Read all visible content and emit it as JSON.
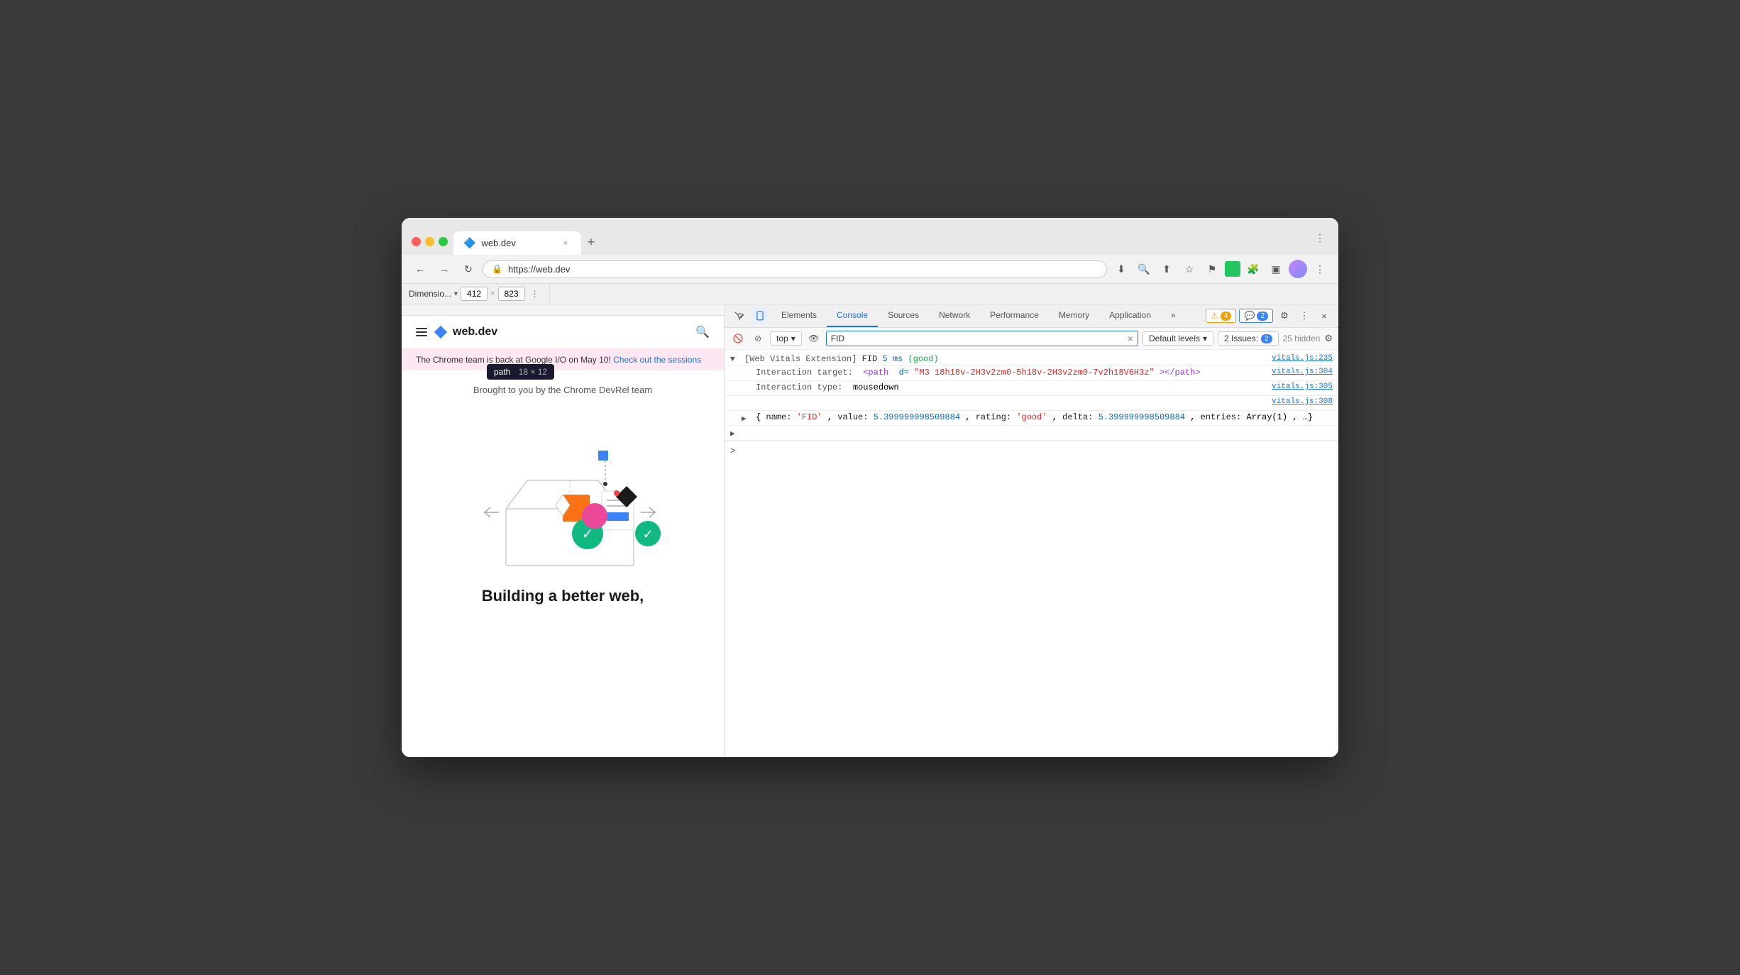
{
  "browser": {
    "tab": {
      "title": "web.dev",
      "favicon": "🔷",
      "close_label": "×"
    },
    "new_tab_label": "+",
    "window_controls": "⋮"
  },
  "toolbar": {
    "back_label": "←",
    "forward_label": "→",
    "refresh_label": "↻",
    "url": "https://web.dev",
    "lock_icon": "🔒",
    "download_icon": "⬇",
    "zoom_icon": "🔍",
    "share_icon": "⬆",
    "bookmark_icon": "★",
    "flag_icon": "⚑",
    "extensions_icon": "🧩",
    "sidebar_icon": "▣",
    "menu_icon": "⋮"
  },
  "devtools_bar": {
    "dimensions_label": "Dimensio...",
    "width": "412",
    "height": "823",
    "separator": "×",
    "more_icon": "⋮"
  },
  "devtools": {
    "tabs": [
      {
        "label": "Elements",
        "active": false
      },
      {
        "label": "Console",
        "active": true
      },
      {
        "label": "Sources",
        "active": false
      },
      {
        "label": "Network",
        "active": false
      },
      {
        "label": "Performance",
        "active": false
      },
      {
        "label": "Memory",
        "active": false
      },
      {
        "label": "Application",
        "active": false
      }
    ],
    "more_tabs": "»",
    "warn_badge": "4",
    "info_badge": "2",
    "settings_icon": "⚙",
    "more_icon": "⋮",
    "close_icon": "×",
    "console_toolbar": {
      "clear_icon": "🚫",
      "filter_icon": "⊘",
      "context": "top",
      "context_arrow": "▾",
      "eye_icon": "👁",
      "filter_value": "FID",
      "filter_clear": "×",
      "default_levels": "Default levels",
      "default_levels_arrow": "▾",
      "issues_label": "2 Issues:",
      "issues_count": "2",
      "hidden_count": "25 hidden",
      "settings_icon": "⚙"
    },
    "console_entries": [
      {
        "id": 1,
        "expanded": true,
        "arrow": "▼",
        "prefix": "[Web Vitals Extension] FID",
        "metric_value": "5 ms",
        "metric_rating": "(good)",
        "source": "vitals.js:235",
        "children": [
          {
            "id": 11,
            "label": "Interaction target:",
            "html_tag_open": "<path",
            "html_attr": "d=",
            "html_value": "\"M3 18h18v-2H3v2zm0-5h18v-2H3v2zm0-7v2h18V6H3z\"",
            "html_tag_close": "></path>",
            "source": "vitals.js:304"
          },
          {
            "id": 12,
            "label": "Interaction type:",
            "value": "mousedown",
            "source": "vitals.js:305"
          },
          {
            "id": 13,
            "empty": true,
            "source": "vitals.js:308"
          },
          {
            "id": 14,
            "arrow": "▶",
            "content": "{name: 'FID', value: 5.399999998509884, rating: 'good', delta: 5.399999998509884, entries: Array(1), …}",
            "name_key": "name:",
            "name_val": "'FID'",
            "value_key": "value:",
            "value_val": "5.399999998509884",
            "rating_key": "rating:",
            "rating_val": "'good'",
            "delta_key": "delta:",
            "delta_val": "5.399999998509884",
            "entries_key": "entries:",
            "entries_val": "Array(1)",
            "more": "…}"
          }
        ]
      }
    ],
    "console_prompt": ">"
  },
  "webpage": {
    "logo_text": "web.dev",
    "search_icon": "🔍",
    "banner_text": "The Chrome team is back at Google I/O on May 10!",
    "banner_link_text": "Check out the sessions",
    "brought_by": "Brought to you by the Chrome DevRel team",
    "building_text": "Building a better web,",
    "tooltip": {
      "label": "path",
      "size": "18 × 12"
    }
  }
}
